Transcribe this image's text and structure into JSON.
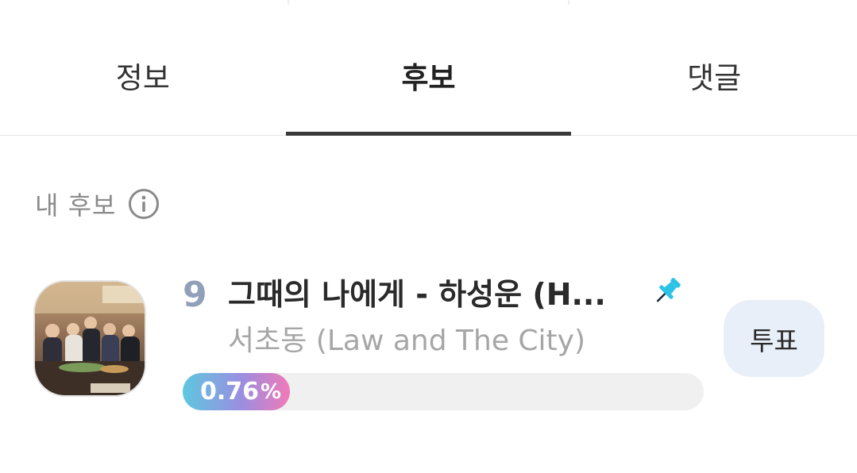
{
  "tabs": [
    {
      "label": "정보",
      "active": false
    },
    {
      "label": "후보",
      "active": true
    },
    {
      "label": "댓글",
      "active": false
    }
  ],
  "section": {
    "title": "내 후보",
    "icon": "info-icon"
  },
  "candidate": {
    "rank": "9",
    "title": "그때의 나에게 - 하성운 (H...",
    "subtitle": "서초동 (Law and The City)",
    "pinned": true,
    "pin_color": "#2ec3e6",
    "percent_value": "0.76",
    "percent_unit": "%",
    "share_percent": 0.76,
    "vote_label": "투표"
  },
  "colors": {
    "accent_gradient": [
      "#5ec7e0",
      "#9b8ee0",
      "#f07ab8"
    ],
    "rank": "#8fa0b8",
    "vote_button_bg": "#e9eff8"
  }
}
